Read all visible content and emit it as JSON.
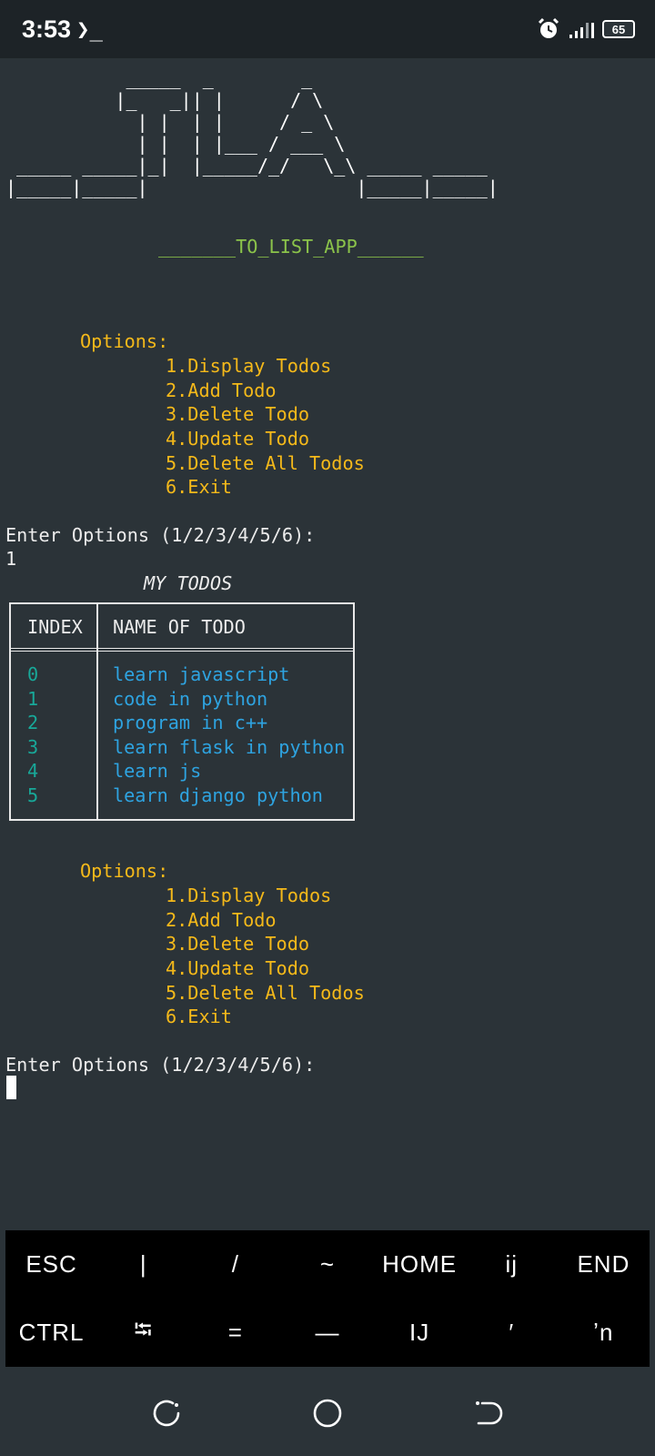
{
  "status_bar": {
    "time": "3:53",
    "prompt_icon": "terminal-prompt-icon",
    "icons": [
      "alarm-icon",
      "signal-icon",
      "battery-icon"
    ],
    "battery": "65"
  },
  "app": {
    "ascii_logo": "           _____  _        _\n          |_   _|| |      / \\\n            | |  | |     / _ \\\n            | |  | |___ / ___ \\\n _____ _____|_|  |_____/_/   \\_\\ _____ _____\n|_____|_____|                   |_____|_____|",
    "subtitle": "_______TO_LIST_APP______"
  },
  "menu": {
    "heading": "Options:",
    "items": [
      "1.Display Todos",
      "2.Add Todo",
      "3.Delete Todo",
      "4.Update Todo",
      "5.Delete All Todos",
      "6.Exit"
    ],
    "prompt": "Enter Options (1/2/3/4/5/6):",
    "first_input": "1"
  },
  "todos": {
    "title": "MY TODOS",
    "headers": {
      "index": "INDEX",
      "name": "NAME OF TODO"
    },
    "rows": [
      {
        "index": "0",
        "name": "learn javascript"
      },
      {
        "index": "1",
        "name": "code in python"
      },
      {
        "index": "2",
        "name": "program in c++"
      },
      {
        "index": "3",
        "name": "learn flask in python"
      },
      {
        "index": "4",
        "name": "learn js"
      },
      {
        "index": "5",
        "name": "learn django python"
      }
    ]
  },
  "extra_keys": {
    "row1": [
      "ESC",
      "|",
      "/",
      "~",
      "HOME",
      "ij",
      "END"
    ],
    "row2": [
      "CTRL",
      "⭾",
      "=",
      "—",
      "IJ",
      "′",
      "ʼn"
    ]
  },
  "nav": [
    "recent-apps-icon",
    "home-icon",
    "back-icon"
  ],
  "colors": {
    "background": "#2b3338",
    "green": "#8bc34a",
    "yellow": "#f5b91a",
    "teal": "#18a899",
    "blue": "#2ea3e0"
  }
}
